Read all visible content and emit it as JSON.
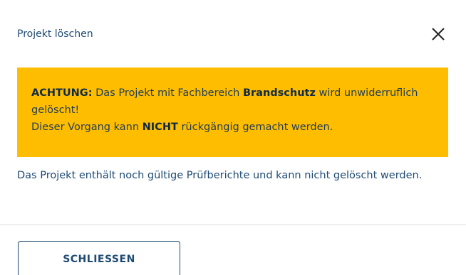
{
  "dialog": {
    "title": "Projekt löschen",
    "close_icon": "close-icon",
    "warning": {
      "label": "ACHTUNG:",
      "text_1": " Das Projekt mit Fachbereich ",
      "fachbereich": "Brandschutz",
      "text_2": " wird unwiderruflich gelöscht!",
      "text_3": "Dieser Vorgang kann ",
      "emphasis": "NICHT",
      "text_4": " rückgängig gemacht werden."
    },
    "info": "Das Projekt enthält noch gültige Prüfberichte und kann nicht gelöscht werden.",
    "close_button_label": "SCHLIESSEN"
  },
  "colors": {
    "warning_bg": "#ffbd00",
    "primary_text": "#1e4a72"
  }
}
